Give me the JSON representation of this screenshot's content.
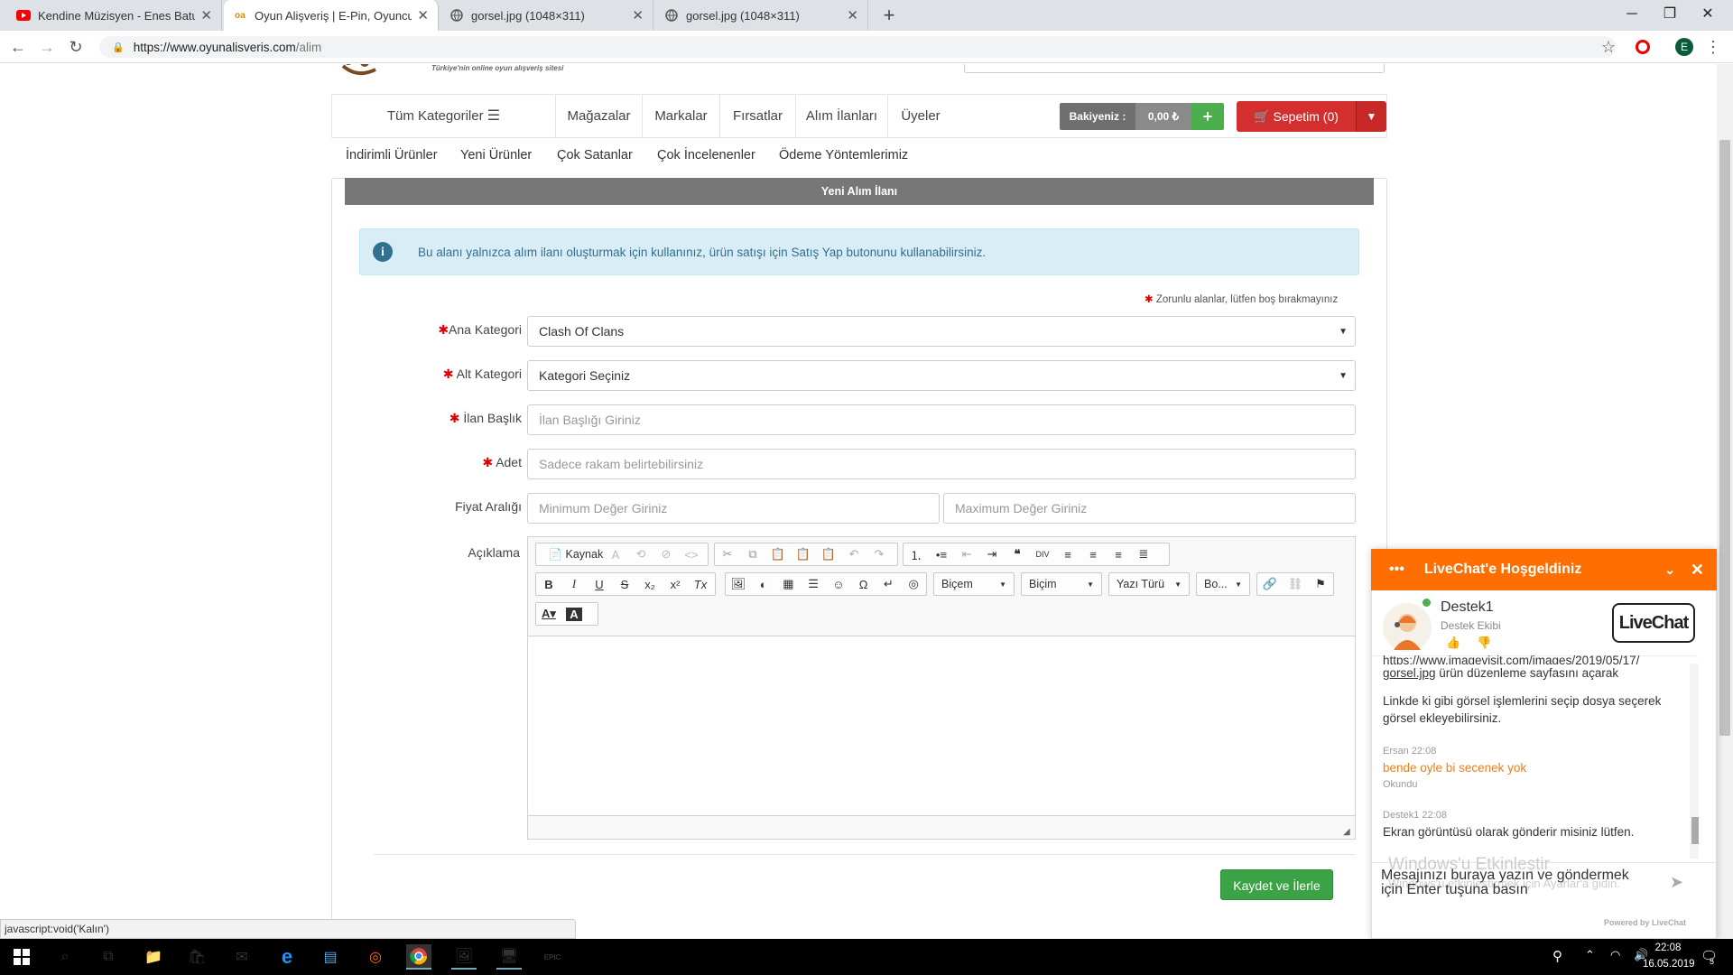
{
  "browser": {
    "tabs": [
      {
        "title": "Kendine Müzisyen - Enes Batur :",
        "icon": "youtube-icon",
        "color": "#ff0000"
      },
      {
        "title": "Oyun Alişveriş | E-Pin, Oyuncu Ür",
        "icon": "oa-logo-icon",
        "color": "#f5a623"
      },
      {
        "title": "gorsel.jpg (1048×311)",
        "icon": "globe-icon"
      },
      {
        "title": "gorsel.jpg (1048×311)",
        "icon": "globe-icon"
      }
    ],
    "new_tab": "+",
    "url_host": "https://www.oyunalisveris.com",
    "url_path": "/alim",
    "profile_initial": "E"
  },
  "site": {
    "tagline": "Türkiye'nin online oyun alışveriş sitesi",
    "nav": {
      "categories": "Tüm Kategoriler",
      "links": [
        "Mağazalar",
        "Markalar",
        "Fırsatlar",
        "Alım İlanları",
        "Üyeler"
      ],
      "balance_label": "Bakiyeniz :",
      "balance_value": "0,00 ₺",
      "add": "+",
      "cart": "Sepetim (0)"
    },
    "subnav": [
      "İndirimli Ürünler",
      "Yeni Ürünler",
      "Çok Satanlar",
      "Çok İncelenenler",
      "Ödeme Yöntemlerimiz"
    ]
  },
  "form": {
    "heading": "Yeni Alım İlanı",
    "info": "Bu alanı yalnızca alım ilanı oluşturmak için kullanınız, ürün satışı için Satış Yap butonunu kullanabilirsiniz.",
    "required_note": "Zorunlu alanlar, lütfen boş bırakmayınız",
    "main_category": {
      "label": "Ana Kategori",
      "value": "Clash Of Clans"
    },
    "sub_category": {
      "label": "Alt Kategori",
      "value": "Kategori Seçiniz"
    },
    "title": {
      "label": "İlan Başlık",
      "placeholder": "İlan Başlığı Giriniz"
    },
    "quantity": {
      "label": "Adet",
      "placeholder": "Sadece rakam belirtebilirsiniz"
    },
    "price": {
      "label": "Fiyat Aralığı",
      "min_placeholder": "Minimum Değer Giriniz",
      "max_placeholder": "Maximum Değer Giriniz"
    },
    "description": {
      "label": "Açıklama"
    },
    "editor": {
      "source": "Kaynak",
      "format1": "Biçem",
      "format2": "Biçim",
      "font": "Yazı Türü",
      "size": "Bo..."
    },
    "submit": "Kaydet ve İlerle"
  },
  "statusbar": "javascript:void('Kalın')",
  "livechat": {
    "title": "LiveChat'e Hoşgeldiniz",
    "agent_name": "Destek1",
    "agent_team": "Destek Ekibi",
    "brand": "LiveChat",
    "messages": [
      {
        "text_link": "https://www.imagevisit.com/images/2019/05/17/",
        "text_link2": "gorsel.jpg",
        "text_rest": " ürün düzenleme sayfasını açarak"
      },
      {
        "text": "Linkde ki gibi görsel işlemlerini seçip dosya seçerek görsel ekleyebilirsiniz."
      }
    ],
    "user_msg": {
      "meta": "Ersan 22:08",
      "text": "bende oyle bi secenek yok",
      "status": "Okundu"
    },
    "agent_msg": {
      "meta": "Destek1 22:08",
      "text": "Ekran görüntüsü olarak gönderir misiniz lütfen."
    },
    "input": "Mesajınızı buraya yazın ve göndermek için Enter tuşuna basın",
    "watermark1": "Windows'u Etkinleştir",
    "watermark2": "Windows'u etkinleştirmek için Ayarlar'a gidin.",
    "powered": "Powered by LiveChat"
  },
  "taskbar": {
    "time": "22:08",
    "date": "16.05.2019",
    "notif_count": "5"
  }
}
